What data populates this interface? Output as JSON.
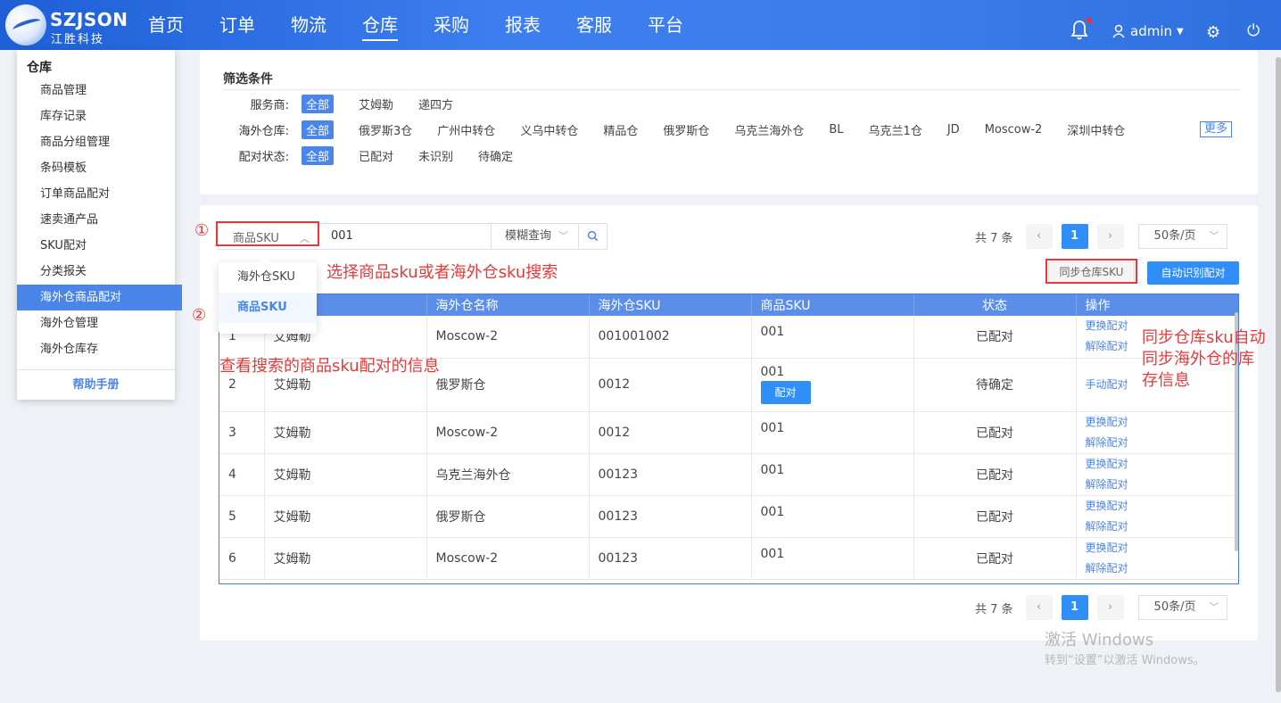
{
  "brand": {
    "name_en": "SZJSON",
    "name_cn": "江胜科技"
  },
  "nav": [
    "首页",
    "订单",
    "物流",
    "仓库",
    "采购",
    "报表",
    "客服",
    "平台"
  ],
  "user": {
    "name": "admin"
  },
  "sidebar": {
    "title": "仓库",
    "items": [
      "商品管理",
      "库存记录",
      "商品分组管理",
      "条码模板",
      "订单商品配对",
      "速卖通产品",
      "SKU配对",
      "分类报关",
      "海外仓商品配对",
      "海外仓管理",
      "海外仓库存"
    ],
    "active_index": 8,
    "help": "帮助手册"
  },
  "filter": {
    "title": "筛选条件",
    "provider_label": "服务商:",
    "providers": [
      "全部",
      "艾姆勒",
      "递四方"
    ],
    "warehouse_label": "海外仓库:",
    "warehouses": [
      "全部",
      "俄罗斯3仓",
      "广州中转仓",
      "义乌中转仓",
      "精品仓",
      "俄罗斯仓",
      "乌克兰海外仓",
      "BL",
      "乌克兰1仓",
      "JD",
      "Moscow-2",
      "深圳中转仓"
    ],
    "more": "更多",
    "status_label": "配对状态:",
    "statuses": [
      "全部",
      "已配对",
      "未识别",
      "待确定"
    ]
  },
  "search": {
    "field": "商品SKU",
    "value": "001",
    "mode": "模糊查询",
    "dropdown": [
      "海外仓SKU",
      "商品SKU"
    ]
  },
  "pager": {
    "total": "共 7 条",
    "page": "1",
    "size": "50条/页"
  },
  "buttons": {
    "sync": "同步仓库SKU",
    "auto": "自动识别配对"
  },
  "table": {
    "headers": [
      "",
      "",
      "海外仓名称",
      "海外仓SKU",
      "商品SKU",
      "状态",
      "操作"
    ],
    "rows": [
      {
        "no": "1",
        "provider": "艾姆勒",
        "wh": "Moscow-2",
        "wsku": "001001002",
        "sku": "001",
        "status": "已配对",
        "ops": [
          "更换配对",
          "解除配对"
        ]
      },
      {
        "no": "2",
        "provider": "艾姆勒",
        "wh": "俄罗斯仓",
        "wsku": "0012",
        "sku": "001",
        "status": "待确定",
        "ops": [
          "手动配对"
        ],
        "match_btn": "配对"
      },
      {
        "no": "3",
        "provider": "艾姆勒",
        "wh": "Moscow-2",
        "wsku": "0012",
        "sku": "001",
        "status": "已配对",
        "ops": [
          "更换配对",
          "解除配对"
        ]
      },
      {
        "no": "4",
        "provider": "艾姆勒",
        "wh": "乌克兰海外仓",
        "wsku": "00123",
        "sku": "001",
        "status": "已配对",
        "ops": [
          "更换配对",
          "解除配对"
        ]
      },
      {
        "no": "5",
        "provider": "艾姆勒",
        "wh": "俄罗斯仓",
        "wsku": "00123",
        "sku": "001",
        "status": "已配对",
        "ops": [
          "更换配对",
          "解除配对"
        ]
      },
      {
        "no": "6",
        "provider": "艾姆勒",
        "wh": "Moscow-2",
        "wsku": "00123",
        "sku": "001",
        "status": "已配对",
        "ops": [
          "更换配对",
          "解除配对"
        ]
      }
    ]
  },
  "annotations": {
    "num1": "①",
    "num2": "②",
    "select_hint": "选择商品sku或者海外仓sku搜索",
    "view_hint": "查看搜索的商品sku配对的信息",
    "sync_hint_1": "同步仓库sku自动",
    "sync_hint_2": "同步海外仓的库",
    "sync_hint_3": "存信息"
  },
  "watermark": {
    "line1": "激活 Windows",
    "line2": "转到“设置”以激活 Windows。"
  },
  "colors": {
    "primary": "#2f8ef8",
    "nav_bg": "#3a7de9",
    "annotation": "#e43a3a"
  }
}
